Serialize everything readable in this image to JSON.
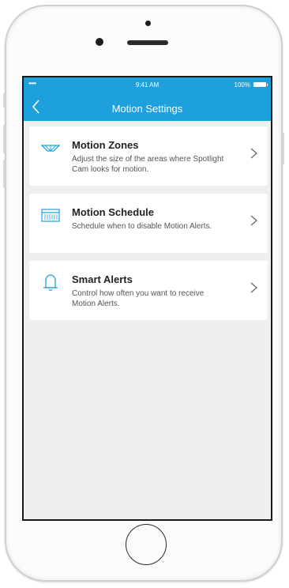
{
  "status_bar": {
    "signal": "•••••",
    "time": "9:41 AM",
    "battery": "100%"
  },
  "nav": {
    "title": "Motion Settings",
    "back_icon": "chevron-left-icon"
  },
  "accent_color": "#1ea0dc",
  "items": [
    {
      "icon": "motion-zone-icon",
      "title": "Motion Zones",
      "description": "Adjust the size of the areas where Spotlight Cam looks for motion."
    },
    {
      "icon": "calendar-icon",
      "title": "Motion Schedule",
      "description": "Schedule when to disable Motion Alerts."
    },
    {
      "icon": "bell-icon",
      "title": "Smart Alerts",
      "description": "Control how often you want to receive Motion Alerts."
    }
  ]
}
